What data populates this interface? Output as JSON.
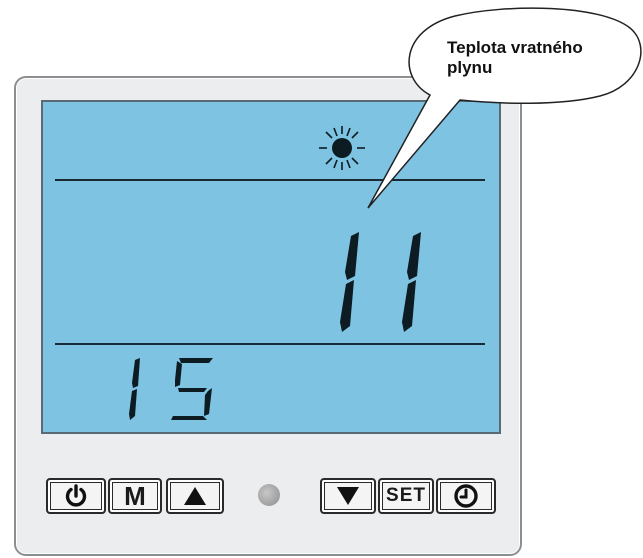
{
  "callout": {
    "text": "Teplota vratného plynu"
  },
  "display": {
    "mode_icon": "sun-icon",
    "main_value": "11",
    "secondary_value": "15"
  },
  "buttons": [
    {
      "name": "power-button",
      "icon": "power-icon",
      "label": ""
    },
    {
      "name": "mode-button",
      "icon": "",
      "label": "M"
    },
    {
      "name": "up-button",
      "icon": "up-triangle-icon",
      "label": ""
    },
    {
      "name": "down-button",
      "icon": "down-triangle-icon",
      "label": ""
    },
    {
      "name": "set-button",
      "icon": "",
      "label": "SET"
    },
    {
      "name": "clock-button",
      "icon": "clock-icon",
      "label": ""
    }
  ],
  "indicator": {
    "name": "status-led",
    "color": "#9a9a9a"
  },
  "colors": {
    "lcd": "#7ec3e2",
    "segment": "#0d1b22",
    "panel": "#ecedef"
  }
}
